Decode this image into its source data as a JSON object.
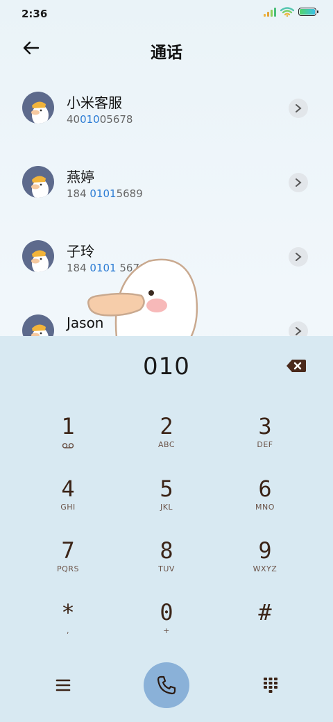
{
  "status": {
    "time": "2:36"
  },
  "header": {
    "title": "通话"
  },
  "contacts": [
    {
      "name": "小米客服",
      "num_pre": "40",
      "num_hl": "010",
      "num_post": "05678"
    },
    {
      "name": "燕婷",
      "num_pre": "184 ",
      "num_hl": "0101",
      "num_post": "5689"
    },
    {
      "name": "子玲",
      "num_pre": "184 ",
      "num_hl": "0101",
      "num_post": " 5678"
    },
    {
      "name": "Jason",
      "num_pre": "",
      "num_hl": "",
      "num_post": ""
    }
  ],
  "dialer": {
    "typed": "010",
    "keys": [
      {
        "digit": "1",
        "letters": "",
        "icon": "voicemail-icon"
      },
      {
        "digit": "2",
        "letters": "ABC"
      },
      {
        "digit": "3",
        "letters": "DEF"
      },
      {
        "digit": "4",
        "letters": "GHI"
      },
      {
        "digit": "5",
        "letters": "JKL"
      },
      {
        "digit": "6",
        "letters": "MNO"
      },
      {
        "digit": "7",
        "letters": "PQRS"
      },
      {
        "digit": "8",
        "letters": "TUV"
      },
      {
        "digit": "9",
        "letters": "WXYZ"
      },
      {
        "digit": "*",
        "letters": ","
      },
      {
        "digit": "0",
        "letters": "+"
      },
      {
        "digit": "#",
        "letters": ""
      }
    ]
  },
  "icons": {
    "back": "back-arrow-icon",
    "backspace": "backspace-icon",
    "menu": "menu-icon",
    "call": "phone-icon",
    "keypad": "keypad-icon"
  },
  "colors": {
    "highlight": "#2c7cd4",
    "keypad_bg": "#d8e9f2",
    "call_button": "#8ab1d8",
    "digit": "#3b2417"
  }
}
